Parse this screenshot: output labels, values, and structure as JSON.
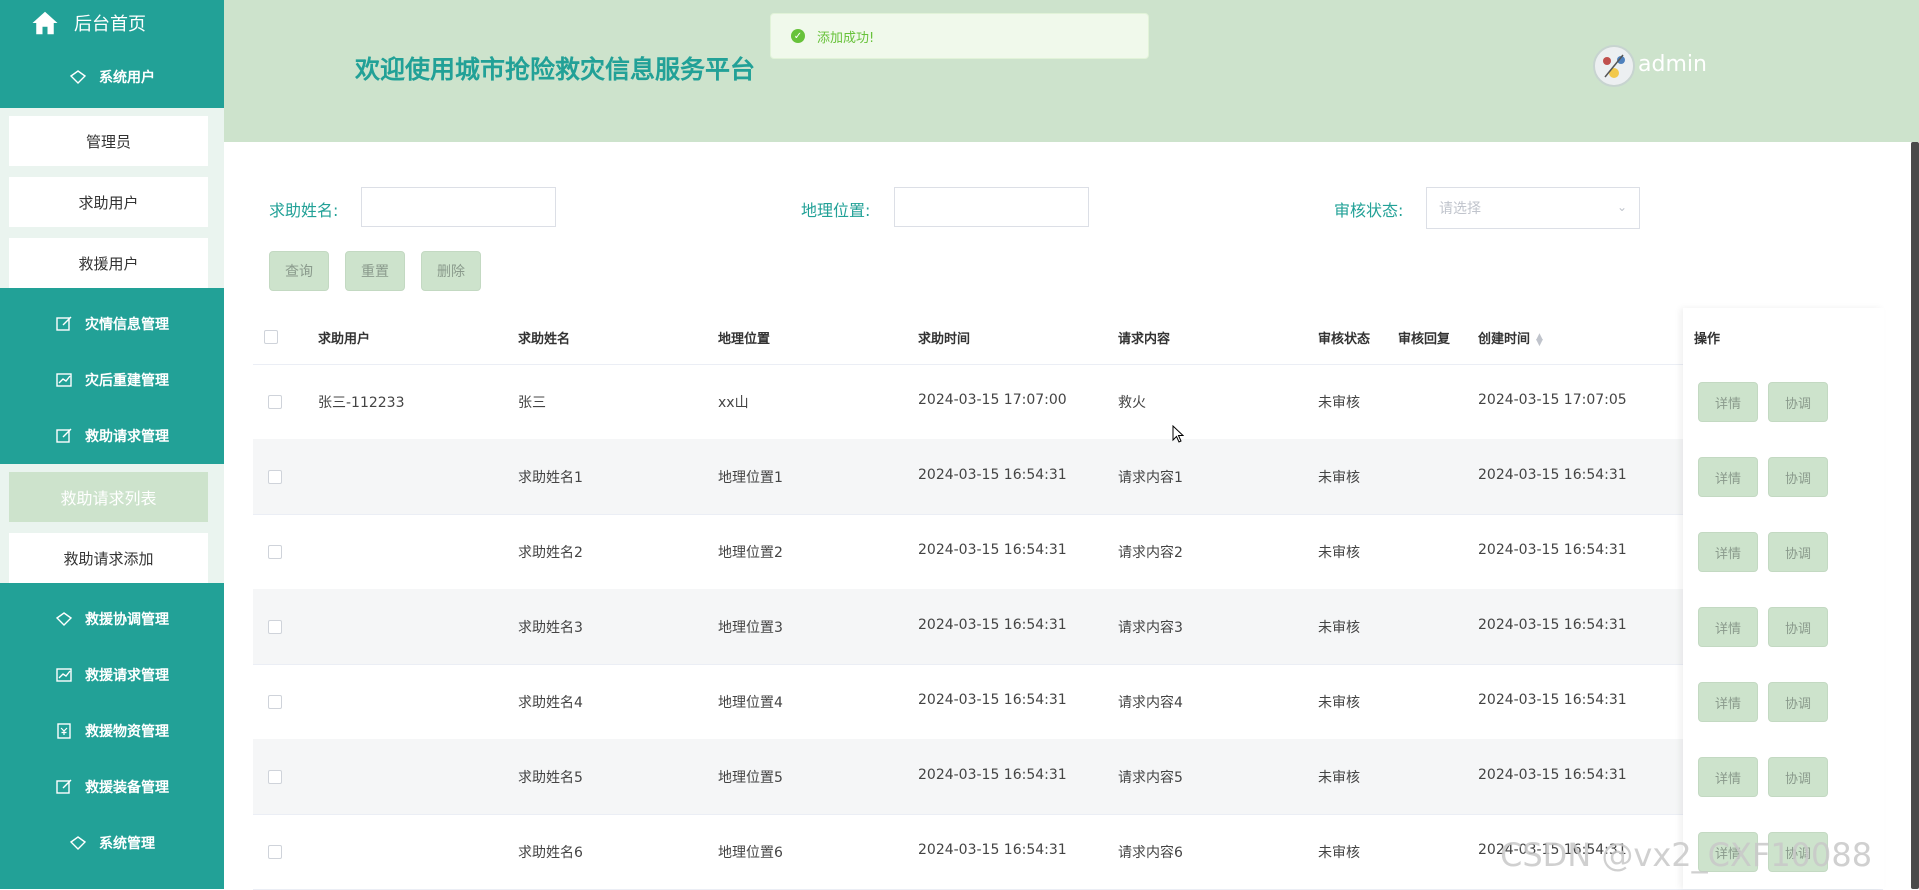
{
  "sidebar": {
    "home": "后台首页",
    "groups": {
      "system_user": "系统用户",
      "disaster_info": "灾情信息管理",
      "rebuild": "灾后重建管理",
      "rescue_request_mgmt": "救助请求管理",
      "rescue_coord": "救援协调管理",
      "rescue_request": "救援请求管理",
      "rescue_supplies": "救援物资管理",
      "rescue_equipment": "救援装备管理",
      "system_mgmt": "系统管理"
    },
    "system_user_items": [
      "管理员",
      "求助用户",
      "救援用户"
    ],
    "rescue_request_items": [
      "救助请求列表",
      "救助请求添加"
    ]
  },
  "header": {
    "title": "欢迎使用城市抢险救灾信息服务平台",
    "username": "admin"
  },
  "toast": {
    "message": "添加成功!"
  },
  "search": {
    "name_label": "求助姓名:",
    "location_label": "地理位置:",
    "status_label": "审核状态:",
    "status_placeholder": "请选择",
    "query_button": "查询",
    "reset_button": "重置",
    "delete_button": "删除"
  },
  "table": {
    "headers": [
      "求助用户",
      "求助姓名",
      "地理位置",
      "求助时间",
      "请求内容",
      "审核状态",
      "审核回复",
      "创建时间",
      "操作"
    ],
    "rows": [
      {
        "user": "张三-112233",
        "name": "张三",
        "location": "xx山",
        "time": "2024-03-15 17:07:00",
        "content": "救火",
        "status": "未审核",
        "reply": "",
        "created": "2024-03-15 17:07:05"
      },
      {
        "user": "",
        "name": "求助姓名1",
        "location": "地理位置1",
        "time": "2024-03-15 16:54:31",
        "content": "请求内容1",
        "status": "未审核",
        "reply": "",
        "created": "2024-03-15 16:54:31"
      },
      {
        "user": "",
        "name": "求助姓名2",
        "location": "地理位置2",
        "time": "2024-03-15 16:54:31",
        "content": "请求内容2",
        "status": "未审核",
        "reply": "",
        "created": "2024-03-15 16:54:31"
      },
      {
        "user": "",
        "name": "求助姓名3",
        "location": "地理位置3",
        "time": "2024-03-15 16:54:31",
        "content": "请求内容3",
        "status": "未审核",
        "reply": "",
        "created": "2024-03-15 16:54:31"
      },
      {
        "user": "",
        "name": "求助姓名4",
        "location": "地理位置4",
        "time": "2024-03-15 16:54:31",
        "content": "请求内容4",
        "status": "未审核",
        "reply": "",
        "created": "2024-03-15 16:54:31"
      },
      {
        "user": "",
        "name": "求助姓名5",
        "location": "地理位置5",
        "time": "2024-03-15 16:54:31",
        "content": "请求内容5",
        "status": "未审核",
        "reply": "",
        "created": "2024-03-15 16:54:31"
      },
      {
        "user": "",
        "name": "求助姓名6",
        "location": "地理位置6",
        "time": "2024-03-15 16:54:31",
        "content": "请求内容6",
        "status": "未审核",
        "reply": "",
        "created": "2024-03-15 16:54:31"
      }
    ],
    "detail_button": "详情",
    "coord_button": "协调"
  },
  "watermark": "CSDN @vx2_CXF10088",
  "colors": {
    "primary": "#22a197",
    "header_bg": "#cde3cc",
    "button_bg": "#cde3cc",
    "toast_text": "#67c23a"
  }
}
